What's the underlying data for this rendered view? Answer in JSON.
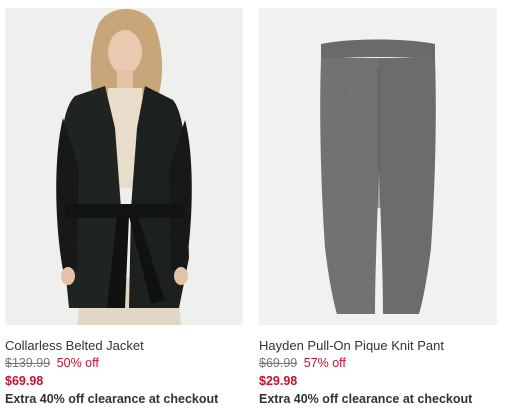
{
  "products": [
    {
      "name": "Collarless Belted Jacket",
      "original_price": "$139.99",
      "percent_off": "50% off",
      "sale_price": "$69.98",
      "promo": "Extra 40% off clearance at checkout",
      "image_subject": "woman-in-black-belted-jacket"
    },
    {
      "name": "Hayden Pull-On Pique Knit Pant",
      "original_price": "$69.99",
      "percent_off": "57% off",
      "sale_price": "$29.98",
      "promo": "Extra 40% off clearance at checkout",
      "image_subject": "gray-knit-pants"
    }
  ],
  "colors": {
    "sale_red": "#c8102e",
    "text": "#333333",
    "strike_gray": "#777777",
    "image_bg": "#f2f2f2"
  }
}
